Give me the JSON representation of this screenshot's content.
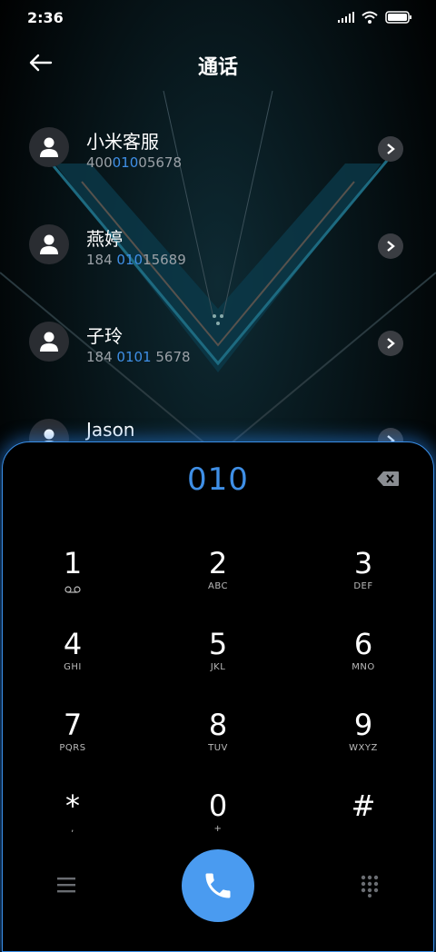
{
  "status": {
    "time": "2:36"
  },
  "header": {
    "title": "通话"
  },
  "contacts": [
    {
      "name": "小米客服",
      "num_a": "400",
      "num_hl": "010",
      "num_b": "05678"
    },
    {
      "name": "燕婷",
      "num_a": "184 ",
      "num_hl": "010",
      "num_b": "15689"
    },
    {
      "name": "子玲",
      "num_a": "184 ",
      "num_hl": "0101",
      "num_b": " 5678"
    },
    {
      "name": "Jason",
      "num_a": "",
      "num_hl": "",
      "num_b": ""
    }
  ],
  "dialer": {
    "input": "010",
    "keys": [
      {
        "digit": "1",
        "letters": ""
      },
      {
        "digit": "2",
        "letters": "ABC"
      },
      {
        "digit": "3",
        "letters": "DEF"
      },
      {
        "digit": "4",
        "letters": "GHI"
      },
      {
        "digit": "5",
        "letters": "JKL"
      },
      {
        "digit": "6",
        "letters": "MNO"
      },
      {
        "digit": "7",
        "letters": "PQRS"
      },
      {
        "digit": "8",
        "letters": "TUV"
      },
      {
        "digit": "9",
        "letters": "WXYZ"
      },
      {
        "digit": "*",
        "letters": ","
      },
      {
        "digit": "0",
        "letters": "+"
      },
      {
        "digit": "#",
        "letters": ""
      }
    ]
  },
  "colors": {
    "accent": "#3f8fe6",
    "call_button": "#4a9bf0",
    "glow": "#3a8fe8"
  },
  "icons": {
    "back": "back-arrow-icon",
    "delete": "backspace-icon",
    "menu": "menu-icon",
    "keypad": "keypad-grid-icon",
    "call": "phone-icon",
    "voicemail": "voicemail-icon"
  }
}
